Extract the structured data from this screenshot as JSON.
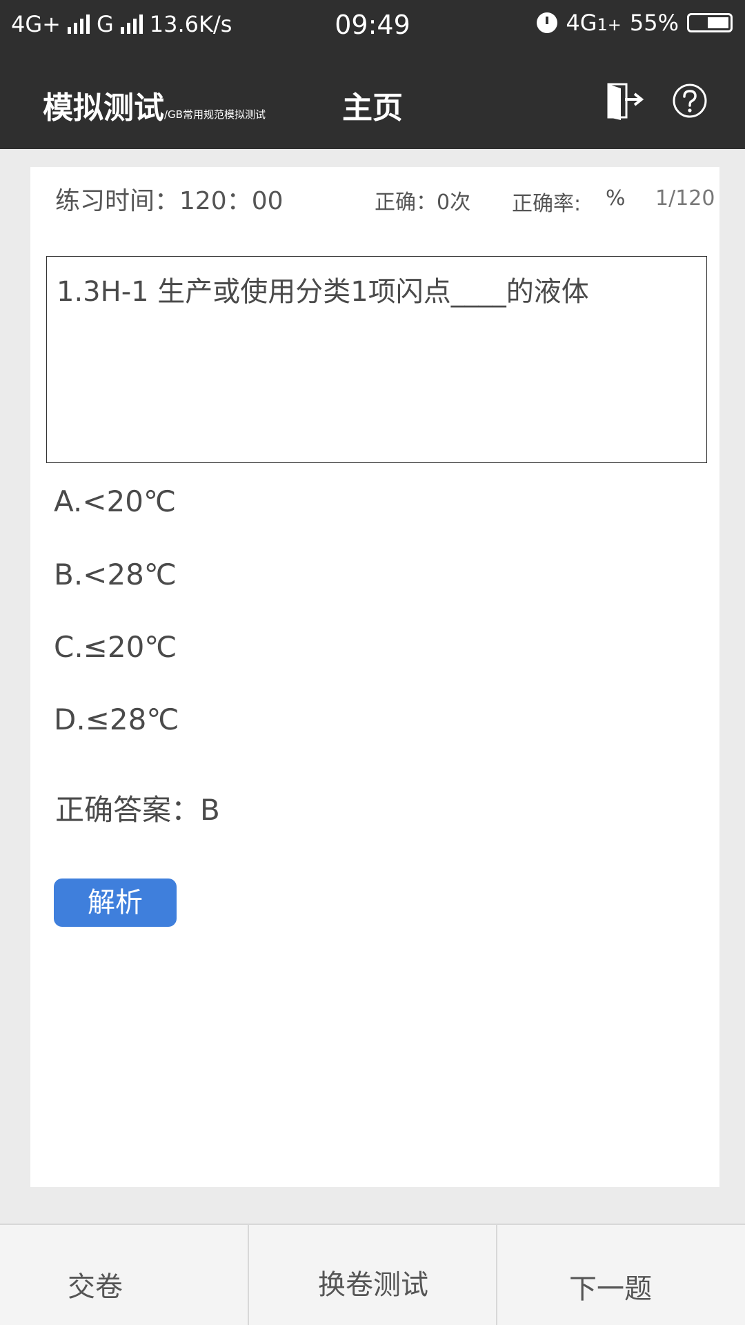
{
  "status_bar": {
    "network1": "4G+",
    "network2": "G",
    "speed": "13.6K/s",
    "time": "09:49",
    "network3": "4G",
    "network3_sub": "1+",
    "battery": "55%",
    "battery_level": 0.55
  },
  "app_bar": {
    "title": "模拟测试",
    "subtitle": "/GB常用规范模拟测试",
    "home": "主页",
    "exit_icon": "exit-door-icon",
    "help_icon": "help-circle-icon"
  },
  "stats": {
    "time_label": "练习时间：120：00",
    "correct": "正确：0次",
    "rate_label": "正确率:",
    "rate_value": "%",
    "progress": "1/120"
  },
  "question": {
    "text": "1.3H-1 生产或使用分类1项闪点____的液体"
  },
  "options": [
    {
      "label": "A.<20℃"
    },
    {
      "label": "B.<28℃"
    },
    {
      "label": "C.≤20℃"
    },
    {
      "label": "D.≤28℃"
    }
  ],
  "answer": "正确答案：B",
  "analysis_button": "解析",
  "bottom": {
    "submit": "交卷",
    "change": "换卷测试",
    "next": "下一题"
  },
  "colors": {
    "bar": "#2f2f2f",
    "accent": "#3f7fdc",
    "background": "#ebebeb"
  }
}
